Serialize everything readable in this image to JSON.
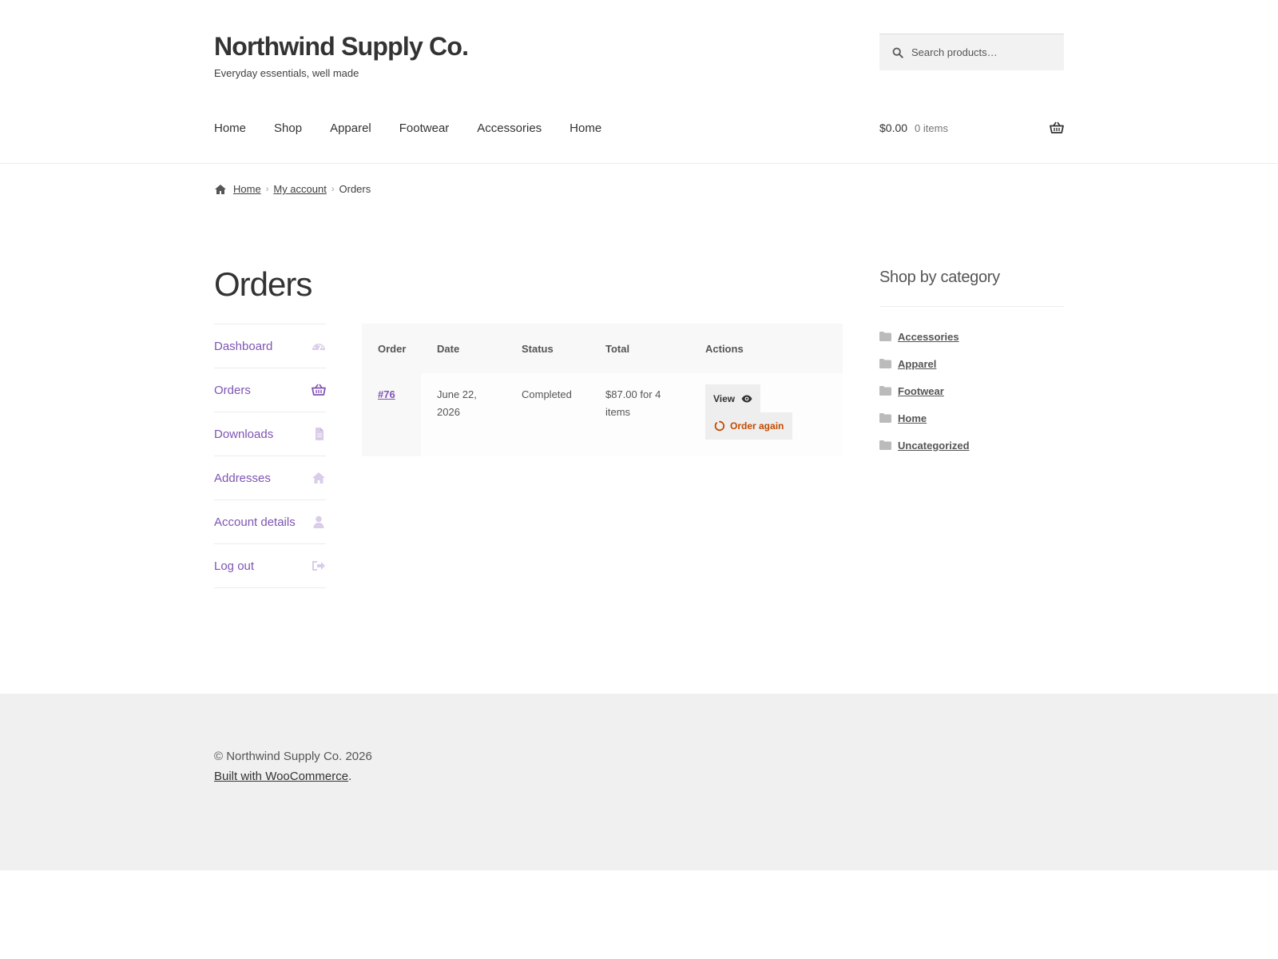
{
  "header": {
    "site_title": "Northwind Supply Co.",
    "tagline": "Everyday essentials, well made",
    "search_placeholder": "Search products…"
  },
  "nav": {
    "items": [
      "Home",
      "Shop",
      "Apparel",
      "Footwear",
      "Accessories",
      "Home"
    ]
  },
  "cart": {
    "amount": "$0.00",
    "count": "0 items"
  },
  "breadcrumb": {
    "home": "Home",
    "account": "My account",
    "current": "Orders"
  },
  "page": {
    "title": "Orders"
  },
  "account_nav": {
    "items": [
      {
        "label": "Dashboard",
        "icon": "dashboard-icon"
      },
      {
        "label": "Orders",
        "icon": "basket-icon"
      },
      {
        "label": "Downloads",
        "icon": "file-icon"
      },
      {
        "label": "Addresses",
        "icon": "home-icon"
      },
      {
        "label": "Account details",
        "icon": "user-icon"
      },
      {
        "label": "Log out",
        "icon": "logout-icon"
      }
    ]
  },
  "orders": {
    "headers": [
      "Order",
      "Date",
      "Status",
      "Total",
      "Actions"
    ],
    "rows": [
      {
        "order": "#76",
        "date": "June 22, 2026",
        "status": "Completed",
        "total": "$87.00 for 4 items",
        "view_label": "View",
        "again_label": "Order again"
      }
    ]
  },
  "sidebar": {
    "title": "Shop by category",
    "categories": [
      "Accessories",
      "Apparel",
      "Footwear",
      "Home",
      "Uncategorized"
    ]
  },
  "footer": {
    "copyright": "© Northwind Supply Co. 2026",
    "built_with": "Built with WooCommerce",
    "built_suffix": "."
  },
  "colors": {
    "accent": "#7f54b3",
    "order_again": "#c34a00",
    "footer_bg": "#f0f0f0"
  }
}
